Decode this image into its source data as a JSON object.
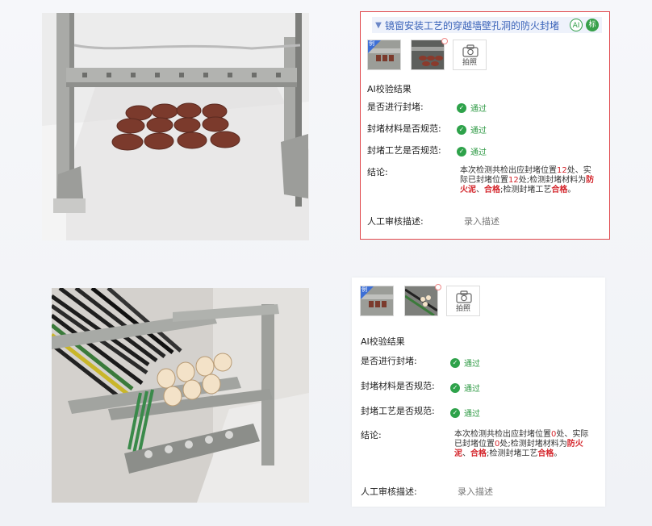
{
  "card1": {
    "title": "镜窗安装工艺的穿越墙壁孔洞的防火封堵",
    "badge_ai": "AI",
    "badge_std": "标",
    "example_tag": "例",
    "camera_label": "拍照",
    "section_title": "AI校验结果",
    "rows": [
      {
        "label": "是否进行封堵:",
        "status": "通过"
      },
      {
        "label": "封堵材料是否规范:",
        "status": "通过"
      },
      {
        "label": "封堵工艺是否规范:",
        "status": "通过"
      }
    ],
    "conclusion_label": "结论:",
    "conclusion": {
      "p1": "本次检测共检出应封堵位置",
      "n1": "12",
      "p2": "处、实际已封堵位置",
      "n2": "12",
      "p3": "处;检测封堵材料为",
      "mat": "防火泥",
      "sep": "、",
      "q1": "合格",
      "p4": ";检测封堵工艺",
      "q2": "合格",
      "end": "。"
    },
    "review_label": "人工审核描述:",
    "review_placeholder": "录入描述"
  },
  "card2": {
    "example_tag": "例",
    "camera_label": "拍照",
    "section_title": "AI校验结果",
    "rows": [
      {
        "label": "是否进行封堵:",
        "status": "通过"
      },
      {
        "label": "封堵材料是否规范:",
        "status": "通过"
      },
      {
        "label": "封堵工艺是否规范:",
        "status": "通过"
      }
    ],
    "conclusion_label": "结论:",
    "conclusion": {
      "p1": "本次检测共检出应封堵位置",
      "n1": "0",
      "p2": "处、实际已封堵位置",
      "n2": "0",
      "p3": "处;检测封堵材料为",
      "mat": "防火泥",
      "sep": "、",
      "q1": "合格",
      "p4": ";检测封堵工艺",
      "q2": "合格",
      "end": "。"
    },
    "review_label": "人工审核描述:",
    "review_placeholder": "录入描述"
  },
  "colors": {
    "pass": "#2ea24a",
    "highlight": "#d4242a",
    "title": "#3a63b9",
    "frame": "#e0464a"
  },
  "icons": [
    "chevron-down-icon",
    "camera-icon",
    "check-circle-icon"
  ]
}
